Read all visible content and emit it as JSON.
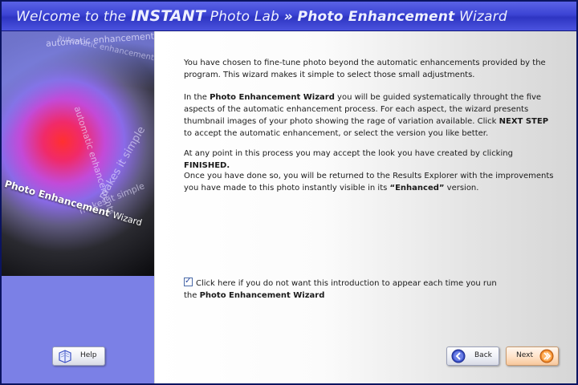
{
  "window": {
    "title_prefix": "Welcome to the",
    "title_brand": "INSTANT",
    "title_brand2": "Photo Lab",
    "title_sep": "»",
    "title_wizard_bold": "Photo Enhancement",
    "title_wizard": "Wizard"
  },
  "sidebar": {
    "curve_text_1": "automatic enhancements",
    "curve_text_2": "automatic enhancements",
    "curve_text_3": "automatic enhancements",
    "curve_text_4": "makes it simple",
    "curve_text_5": "makes it simple",
    "title_bold": "Photo Enhancement",
    "title_light": "Wizard"
  },
  "content": {
    "p1": "You have chosen to fine-tune photo beyond the automatic enhancements provided by the program. This wizard makes it simple to select those small adjustments.",
    "p2_a": "In the ",
    "p2_b": "Photo Enhancement Wizard",
    "p2_c": " you will be guided systematically throught the five aspects of the automatic enhancement process. For each aspect, the wizard presents thumbnail images of your photo showing the rage of variation available. Click ",
    "p2_d": "NEXT STEP",
    "p2_e": "to accept the automatic enhancement, or select the version you like better.",
    "p3_a": "At any point in this process you may accept the look you have created by clicking ",
    "p3_b": "FINISHED.",
    "p4_a": "Once you have done so, you will be returned to the Results Explorer with the improvements you have made to this photo instantly visible in its ",
    "p4_b": "“Enhanced”",
    "p4_c": " version.",
    "option_text": "Click here if you do not want this introduction to appear each time you run",
    "option_text2_a": "the ",
    "option_text2_b": "Photo Enhancement Wizard",
    "option_checked": true
  },
  "buttons": {
    "help": "Help",
    "back": "Back",
    "next": "Next"
  },
  "icons": {
    "help": "help-book-icon",
    "back": "back-arrow-icon",
    "next": "next-arrow-icon",
    "check": "checkmark-icon"
  },
  "colors": {
    "titlebar": "#3c44d4",
    "sidebar": "#7b80e6",
    "next_button": "#f7c79b",
    "back_icon": "#3a4fc4",
    "next_icon": "#f08a2a"
  }
}
